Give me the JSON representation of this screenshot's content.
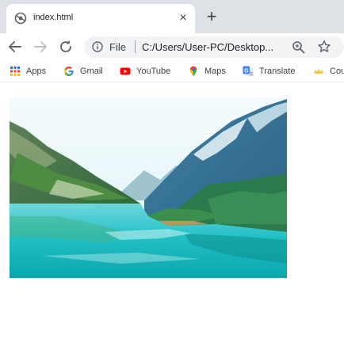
{
  "tab": {
    "title": "index.html",
    "close_symbol": "×"
  },
  "new_tab_symbol": "+",
  "omnibox": {
    "scheme_label": "File",
    "url": "C:/Users/User-PC/Desktop..."
  },
  "icons": {
    "tab": "globe-icon",
    "back": "back-arrow-icon",
    "forward": "forward-arrow-icon",
    "reload": "reload-icon",
    "info": "info-icon",
    "zoom": "zoom-icon",
    "bookmark": "star-icon"
  },
  "bookmarks": [
    {
      "label": "Apps",
      "icon": "apps-grid-icon"
    },
    {
      "label": "Gmail",
      "icon": "google-icon"
    },
    {
      "label": "YouTube",
      "icon": "youtube-icon"
    },
    {
      "label": "Maps",
      "icon": "maps-pin-icon"
    },
    {
      "label": "Translate",
      "icon": "translate-icon"
    },
    {
      "label": "Cou",
      "icon": "crown-icon"
    }
  ],
  "colors": {
    "tab_strip": "#dee1e6",
    "omnibox": "#f1f3f4",
    "youtube_red": "#ff0000",
    "translate_blue": "#4285f4",
    "water_turquoise": "#1fbfc4"
  }
}
